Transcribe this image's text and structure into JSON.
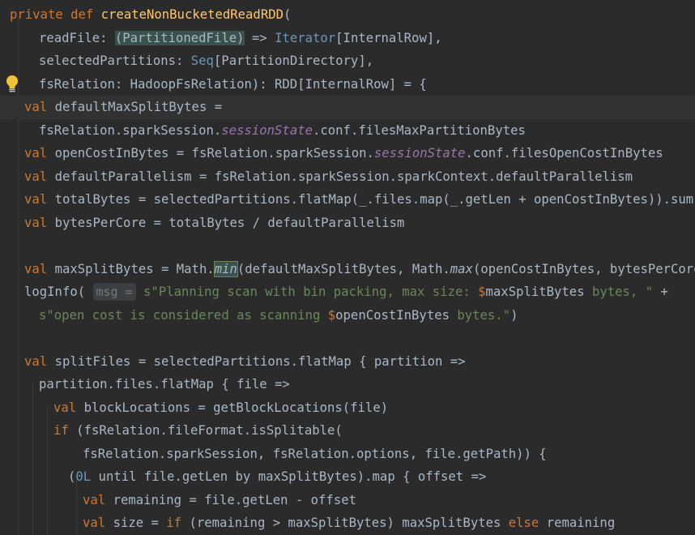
{
  "editor": {
    "lines": [
      "private def createNonBucketedReadRDD(",
      "readFile: (PartitionedFile) => Iterator[InternalRow],",
      "selectedPartitions: Seq[PartitionDirectory],",
      "fsRelation: HadoopFsRelation): RDD[InternalRow] = {",
      "val defaultMaxSplitBytes =",
      "fsRelation.sparkSession.sessionState.conf.filesMaxPartitionBytes",
      "val openCostInBytes = fsRelation.sparkSession.sessionState.conf.filesOpenCostInBytes",
      "val defaultParallelism = fsRelation.sparkSession.sparkContext.defaultParallelism",
      "val totalBytes = selectedPartitions.flatMap(_.files.map(_.getLen + openCostInBytes)).sum",
      "val bytesPerCore = totalBytes / defaultParallelism",
      "",
      "val maxSplitBytes = Math.min(defaultMaxSplitBytes, Math.max(openCostInBytes, bytesPerCore))",
      "logInfo( msg = s\"Planning scan with bin packing, max size: $maxSplitBytes bytes, \" +",
      "s\"open cost is considered as scanning $openCostInBytes bytes.\")",
      "",
      "val splitFiles = selectedPartitions.flatMap { partition =>",
      "partition.files.flatMap { file =>",
      "val blockLocations = getBlockLocations(file)",
      "if (fsRelation.fileFormat.isSplitable(",
      "fsRelation.sparkSession, fsRelation.options, file.getPath)) {",
      "(0L until file.getLen by maxSplitBytes).map { offset =>",
      "val remaining = file.getLen - offset",
      "val size = if (remaining > maxSplitBytes) maxSplitBytes else remaining"
    ],
    "current_line": 5,
    "lightbulb_icon": "lightbulb-icon"
  }
}
